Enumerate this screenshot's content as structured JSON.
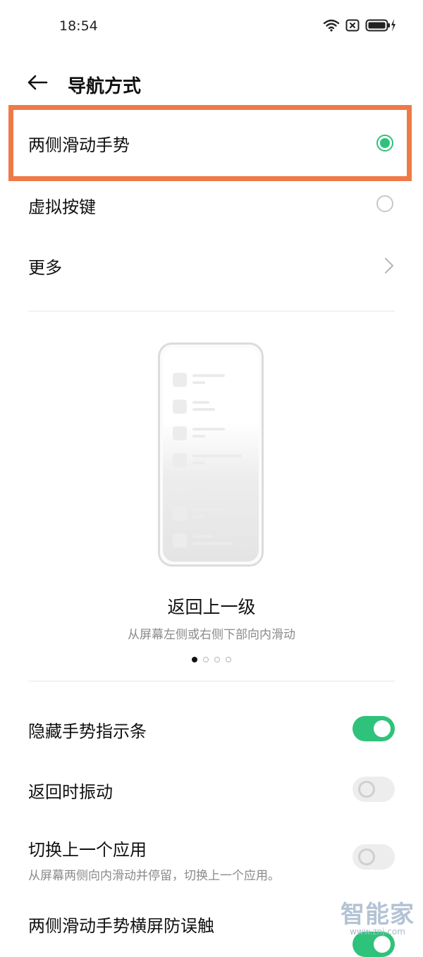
{
  "status_bar": {
    "time": "18:54"
  },
  "header": {
    "title": "导航方式",
    "back_icon": "arrow-left-icon"
  },
  "options": [
    {
      "label": "两侧滑动手势",
      "selected": true
    },
    {
      "label": "虚拟按键",
      "selected": false
    }
  ],
  "more": {
    "label": "更多",
    "icon": "chevron-right-icon"
  },
  "illustration": {
    "title": "返回上一级",
    "subtitle": "从屏幕左侧或右侧下部向内滑动",
    "page_count": 4,
    "active_page": 1
  },
  "settings": [
    {
      "label": "隐藏手势指示条",
      "enabled": true
    },
    {
      "label": "返回时振动",
      "enabled": false
    },
    {
      "label": "切换上一个应用",
      "sublabel": "从屏幕两侧向内滑动并停留，切换上一个应用。",
      "enabled": false
    },
    {
      "label": "两侧滑动手势横屏防误触",
      "enabled": true
    }
  ],
  "watermark": {
    "name": "智能家",
    "url": "www.znj.com"
  },
  "colors": {
    "accent": "#2fc27a",
    "highlight": "#ef7a47"
  }
}
